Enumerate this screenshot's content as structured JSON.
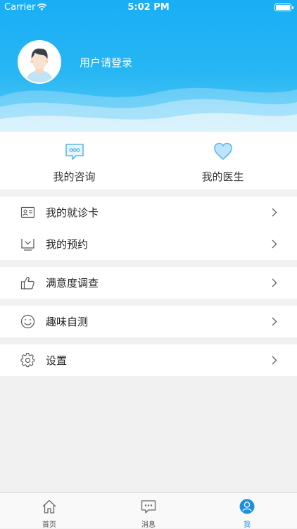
{
  "status_bar": {
    "carrier": "Carrier",
    "time": "5:02 PM"
  },
  "profile": {
    "login_text": "用户请登录"
  },
  "quick": [
    {
      "label": "我的咨询",
      "icon": "chat-bubble-icon"
    },
    {
      "label": "我的医生",
      "icon": "heart-icon"
    }
  ],
  "menu": {
    "card": "我的就诊卡",
    "appointment": "我的预约",
    "survey": "满意度调查",
    "selftest": "趣味自测",
    "settings": "设置"
  },
  "tabbar": {
    "home": "首页",
    "messages": "消息",
    "me": "我",
    "active": "我"
  },
  "colors": {
    "header": "#1eb1f4",
    "accent": "#1a8fe3",
    "icon_blue": "#59b8f0"
  }
}
